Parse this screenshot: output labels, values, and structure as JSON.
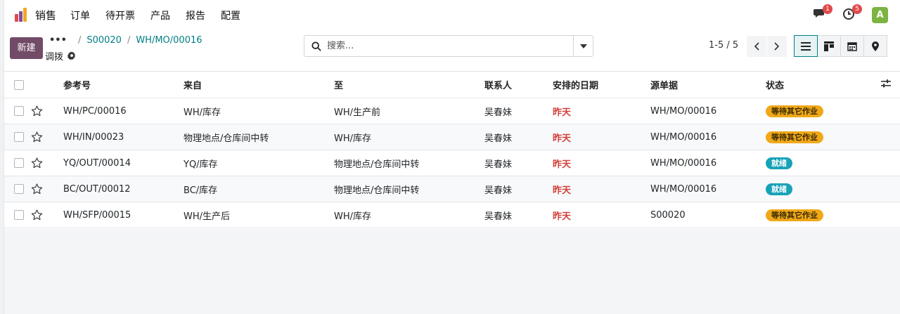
{
  "navbar": {
    "app_name": "销售",
    "menu": [
      "订单",
      "待开票",
      "产品",
      "报告",
      "配置"
    ],
    "messages_count": "1",
    "activities_count": "5",
    "avatar_letter": "A"
  },
  "control": {
    "new_label": "新建",
    "breadcrumb": [
      "S00020",
      "WH/MO/00016"
    ],
    "subtitle": "调拨",
    "search_placeholder": "搜索...",
    "pager": "1-5 / 5"
  },
  "table": {
    "headers": [
      "参考号",
      "来自",
      "至",
      "联系人",
      "安排的日期",
      "源单据",
      "状态"
    ],
    "rows": [
      {
        "ref": "WH/PC/00016",
        "from": "WH/库存",
        "to": "WH/生产前",
        "contact": "吴春妹",
        "date": "昨天",
        "source": "WH/MO/00016",
        "status": "等待其它作业"
      },
      {
        "ref": "WH/IN/00023",
        "from": "物理地点/仓库间中转",
        "to": "WH/库存",
        "contact": "吴春妹",
        "date": "昨天",
        "source": "WH/MO/00016",
        "status": "等待其它作业"
      },
      {
        "ref": "YQ/OUT/00014",
        "from": "YQ/库存",
        "to": "物理地点/仓库间中转",
        "contact": "吴春妹",
        "date": "昨天",
        "source": "WH/MO/00016",
        "status": "就绪"
      },
      {
        "ref": "BC/OUT/00012",
        "from": "BC/库存",
        "to": "物理地点/仓库间中转",
        "contact": "吴春妹",
        "date": "昨天",
        "source": "WH/MO/00016",
        "status": "就绪"
      },
      {
        "ref": "WH/SFP/00015",
        "from": "WH/生产后",
        "to": "WH/库存",
        "contact": "吴春妹",
        "date": "昨天",
        "source": "S00020",
        "status": "等待其它作业"
      }
    ]
  },
  "colors": {
    "brand": "#714b67",
    "link": "#017e84",
    "overdue": "#d23f3a",
    "status_waiting": "#f0a818",
    "status_ready": "#17a2b8"
  }
}
